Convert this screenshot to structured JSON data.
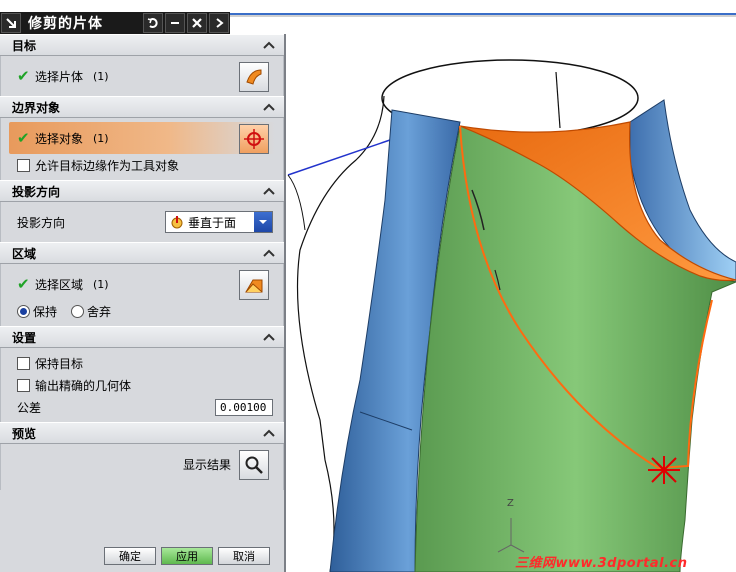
{
  "dialog": {
    "title": "修剪的片体",
    "sections": {
      "target": {
        "title": "目标",
        "select_label": "选择片体",
        "count": "(1)"
      },
      "boundary": {
        "title": "边界对象",
        "select_label": "选择对象",
        "count": "(1)",
        "allow_edge_label": "允许目标边缘作为工具对象"
      },
      "projection": {
        "title": "投影方向",
        "label": "投影方向",
        "value": "垂直于面"
      },
      "region": {
        "title": "区域",
        "select_label": "选择区域",
        "count": "(1)",
        "keep_label": "保持",
        "discard_label": "舍弃",
        "selected": "keep"
      },
      "settings": {
        "title": "设置",
        "keep_target_label": "保持目标",
        "precise_geom_label": "输出精确的几何体",
        "tolerance_label": "公差",
        "tolerance_value": "0.00100"
      },
      "preview": {
        "title": "预览",
        "show_result_label": "显示结果"
      }
    },
    "buttons": {
      "ok": "确定",
      "apply": "应用",
      "cancel": "取消"
    }
  },
  "viewport": {
    "axis_label": "Z",
    "watermark": "三维网www.3dportal.cn",
    "colors": {
      "blue_face": "#4a7fc0",
      "green_face": "#7bbf6a",
      "orange_face": "#f07a1a"
    }
  }
}
